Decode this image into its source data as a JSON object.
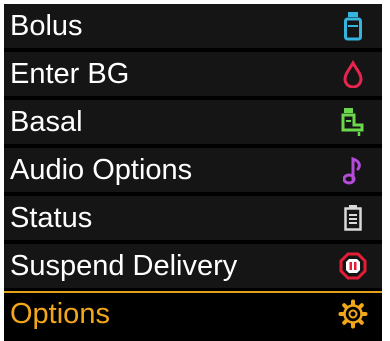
{
  "menu": {
    "items": [
      {
        "label": "Bolus",
        "icon": "bolus-vial-icon",
        "color": "#35b4de"
      },
      {
        "label": "Enter BG",
        "icon": "blood-drop-icon",
        "color": "#e8244f"
      },
      {
        "label": "Basal",
        "icon": "basal-faucet-icon",
        "color": "#6cd64c"
      },
      {
        "label": "Audio Options",
        "icon": "music-note-icon",
        "color": "#b64ad9"
      },
      {
        "label": "Status",
        "icon": "status-clipboard-icon",
        "color": "#d9d9d9"
      },
      {
        "label": "Suspend Delivery",
        "icon": "suspend-stop-icon",
        "color": "#e31d35"
      },
      {
        "label": "Options",
        "icon": "gear-icon",
        "color": "#f2a71b",
        "selected": true
      }
    ]
  }
}
